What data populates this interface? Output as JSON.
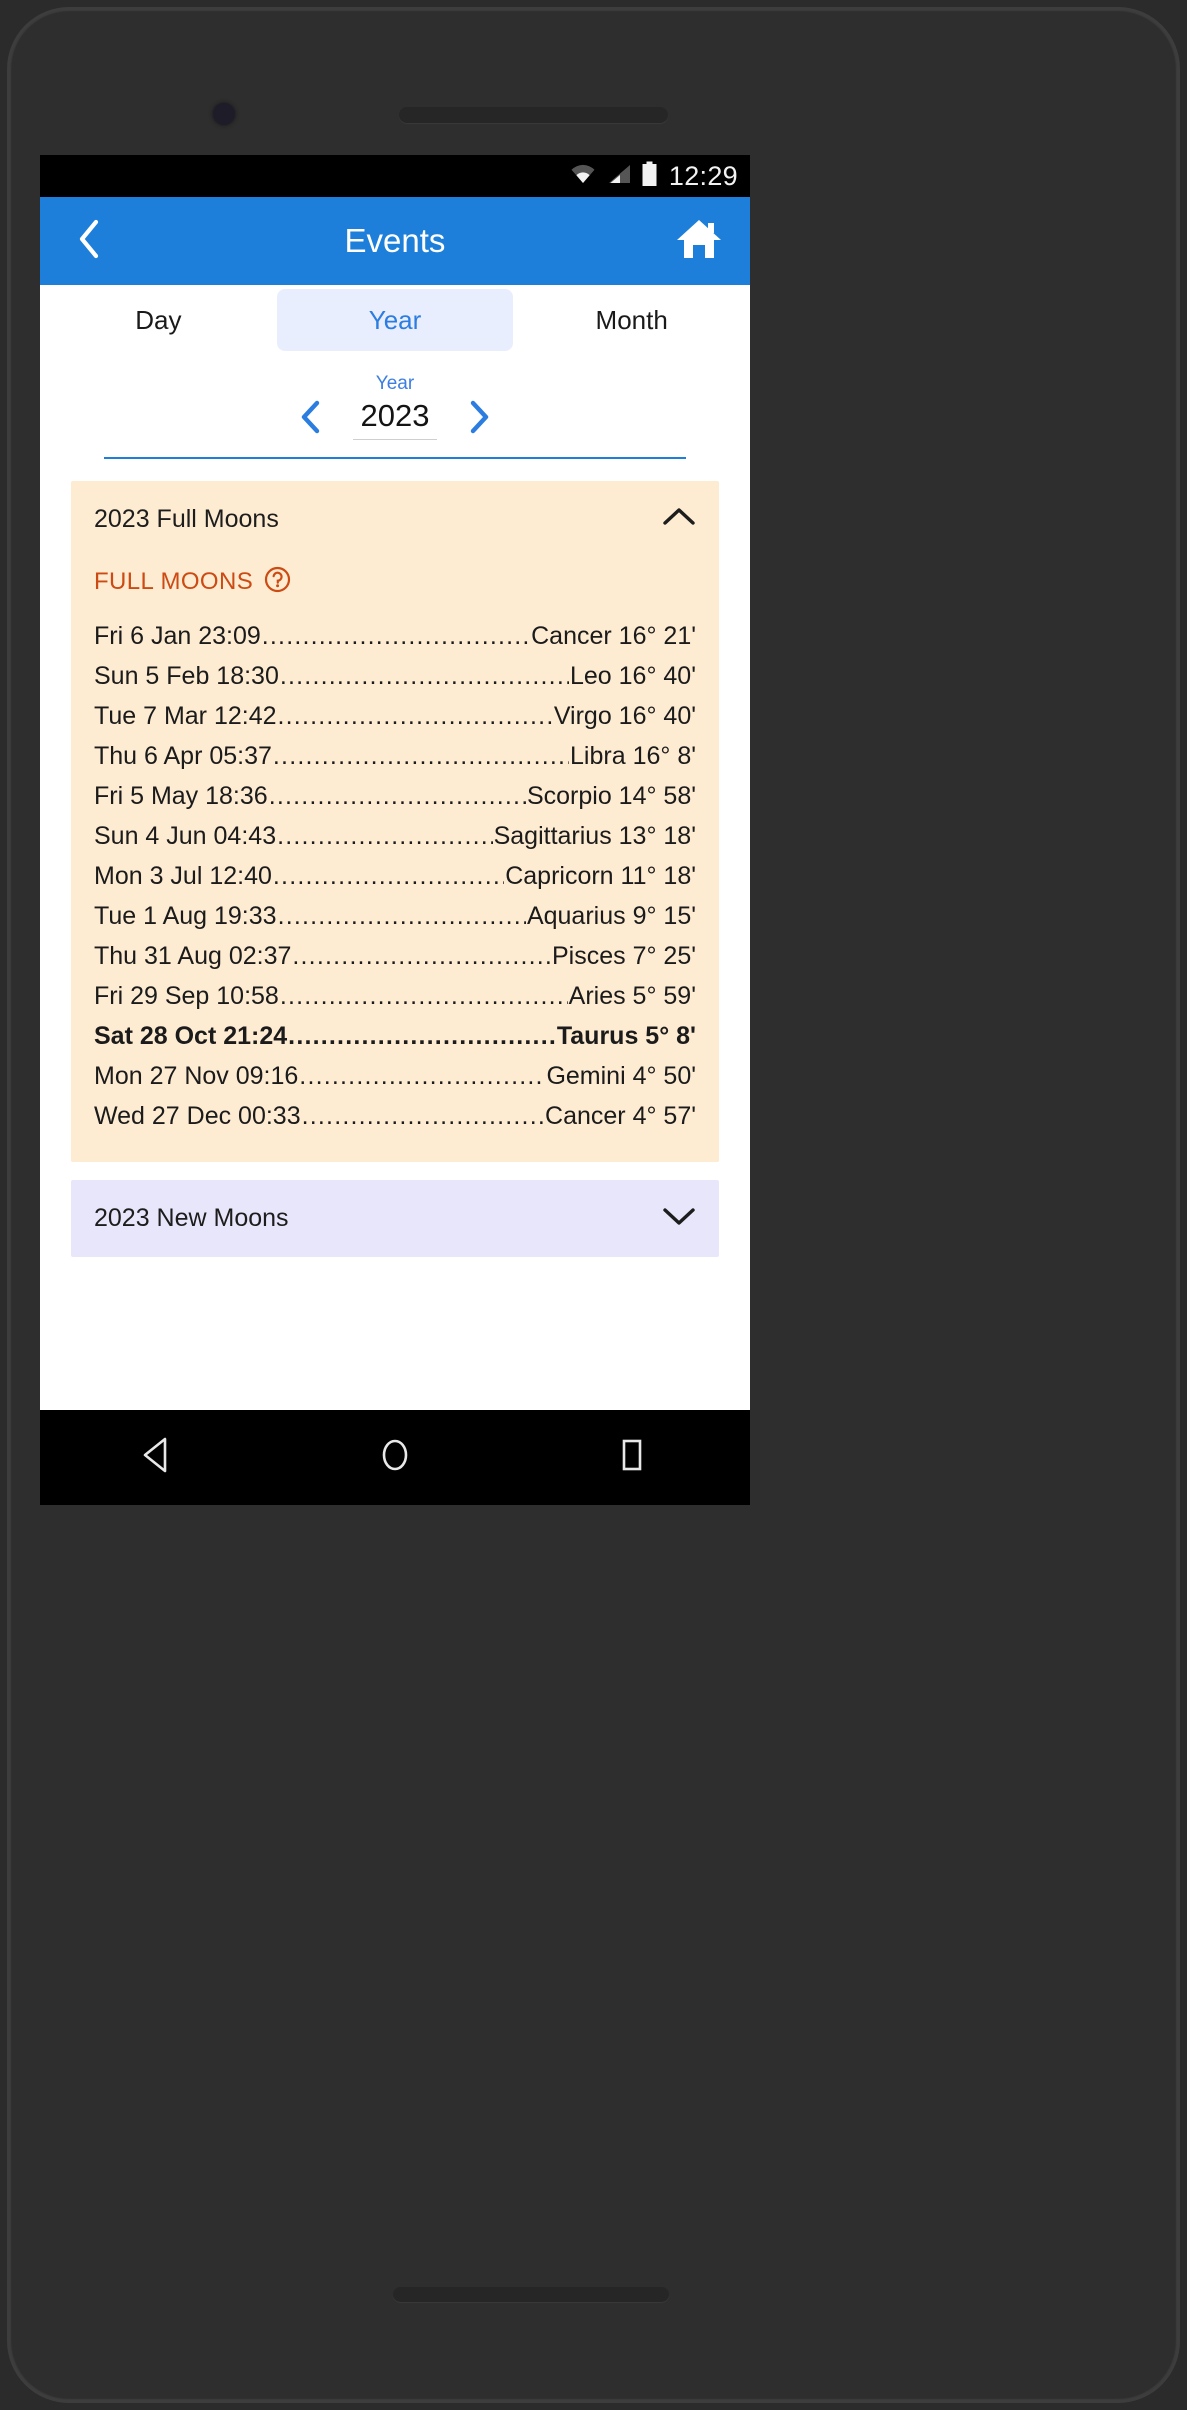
{
  "status_bar": {
    "time": "12:29",
    "icons": [
      "wifi-icon",
      "cellular-signal-icon",
      "battery-icon"
    ]
  },
  "app_bar": {
    "title": "Events",
    "back_icon": "chevron-left-icon",
    "home_icon": "home-icon"
  },
  "tabs": [
    {
      "label": "Day",
      "active": false
    },
    {
      "label": "Year",
      "active": true
    },
    {
      "label": "Month",
      "active": false
    }
  ],
  "year_selector": {
    "label": "Year",
    "value": "2023",
    "prev_icon": "chevron-left-icon",
    "next_icon": "chevron-right-icon"
  },
  "sections": [
    {
      "id": "full-moons",
      "header": "2023 Full Moons",
      "expanded": true,
      "chevron_icon": "chevron-up-icon",
      "group_label": "FULL MOONS",
      "help_icon": "help-circle-icon",
      "events": [
        {
          "when": "Fri 6 Jan 23:09",
          "position": "Cancer 16° 21'",
          "highlight": false
        },
        {
          "when": "Sun 5 Feb 18:30",
          "position": "Leo 16° 40'",
          "highlight": false
        },
        {
          "when": "Tue 7 Mar 12:42",
          "position": "Virgo 16° 40'",
          "highlight": false
        },
        {
          "when": "Thu 6 Apr 05:37",
          "position": "Libra 16° 8'",
          "highlight": false
        },
        {
          "when": "Fri 5 May 18:36",
          "position": "Scorpio 14° 58'",
          "highlight": false
        },
        {
          "when": "Sun 4 Jun 04:43",
          "position": "Sagittarius 13° 18'",
          "highlight": false
        },
        {
          "when": "Mon 3 Jul 12:40",
          "position": "Capricorn 11° 18'",
          "highlight": false
        },
        {
          "when": "Tue 1 Aug 19:33",
          "position": "Aquarius 9° 15'",
          "highlight": false
        },
        {
          "when": "Thu 31 Aug 02:37",
          "position": "Pisces 7° 25'",
          "highlight": false
        },
        {
          "when": "Fri 29 Sep 10:58",
          "position": "Aries 5° 59'",
          "highlight": false
        },
        {
          "when": "Sat 28 Oct 21:24",
          "position": "Taurus 5° 8'",
          "highlight": true
        },
        {
          "when": "Mon 27 Nov 09:16",
          "position": "Gemini 4° 50'",
          "highlight": false
        },
        {
          "when": "Wed 27 Dec 00:33",
          "position": "Cancer 4° 57'",
          "highlight": false
        }
      ]
    },
    {
      "id": "new-moons",
      "header": "2023 New Moons",
      "expanded": false,
      "chevron_icon": "chevron-down-icon",
      "group_label": "",
      "help_icon": "",
      "events": []
    }
  ],
  "nav_bar": {
    "back_icon": "triangle-back-icon",
    "home_icon": "circle-home-icon",
    "recents_icon": "square-recents-icon"
  },
  "colors": {
    "accent_blue": "#1d7fd9",
    "tab_active_bg": "#e9eeff",
    "full_moons_bg": "#fdebd2",
    "new_moons_bg": "#e8e6fa",
    "group_label": "#cc4b13"
  }
}
